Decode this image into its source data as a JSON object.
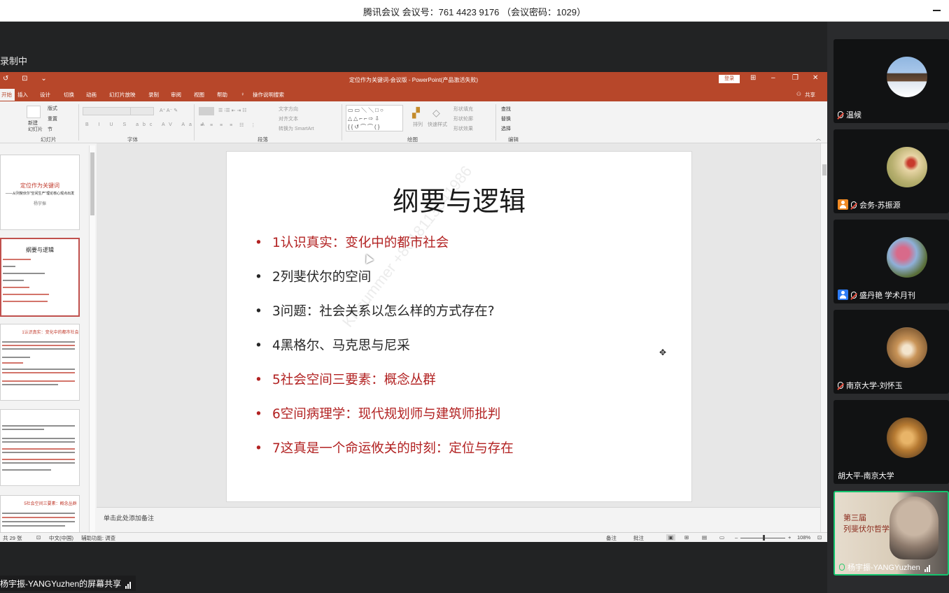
{
  "meeting": {
    "title": "腾讯会议 会议号：761 4423 9176 （会议密码：1029）",
    "recording": "录制中",
    "share_label": "杨宇振-YANGYuzhen的屏幕共享"
  },
  "powerpoint": {
    "window_title": "定位作为关键词-会议版  -  PowerPoint(产品激活失败)",
    "login_button": "登录",
    "share_button": "共享",
    "tell_me": "操作说明搜索",
    "tabs": [
      "开始",
      "插入",
      "设计",
      "切换",
      "动画",
      "幻灯片放映",
      "录制",
      "审阅",
      "视图",
      "帮助"
    ],
    "ribbon_groups": [
      "幻灯片",
      "字体",
      "段落",
      "绘图",
      "编辑"
    ],
    "ribbon_items": {
      "new_slide": "新建\n幻灯片",
      "layout": "版式",
      "reset": "重置",
      "section": "节",
      "text_direction": "文字方向",
      "align_text": "对齐文本",
      "smartart": "转换为 SmartArt",
      "arrange": "排列",
      "quick_styles": "快速样式",
      "shape_fill": "形状填充",
      "shape_outline": "形状轮廓",
      "shape_effects": "形状效果",
      "find": "查找",
      "replace": "替换",
      "select": "选择"
    },
    "thumbnails": [
      {
        "title": "定位作为关键词",
        "subtitle": "——从列斐伏尔“空间生产”理论核心观点出发",
        "author": "杨宇振"
      },
      {
        "title": "纲要与逻辑"
      },
      {
        "title": "1认识真实：变化中的都市社会"
      },
      {
        "title": ""
      },
      {
        "title": "5社会空间三要素：概念丛群"
      }
    ],
    "slide": {
      "title": "纲要与逻辑",
      "bullets": [
        {
          "text": "1认识真实：变化中的都市社会",
          "color": "red"
        },
        {
          "text": "2列斐伏尔的空间",
          "color": "black"
        },
        {
          "text": "3问题：社会关系以怎么样的方式存在?",
          "color": "black"
        },
        {
          "text": "4黑格尔、马克思与尼采",
          "color": "black"
        },
        {
          "text": "5社会空间三要素：概念丛群",
          "color": "red"
        },
        {
          "text": "6空间病理学：现代规划师与建筑师批判",
          "color": "red"
        },
        {
          "text": "7这真是一个命运攸关的时刻：定位与存在",
          "color": "red"
        }
      ],
      "watermark": "KKsummer +8618113041986"
    },
    "notes_placeholder": "单击此处添加备注",
    "status": {
      "slide_count": "共 29 张",
      "language": "中文(中国)",
      "accessibility": "辅助功能: 调查",
      "notes": "备注",
      "comments": "批注",
      "zoom": "108%"
    }
  },
  "participants": [
    {
      "name": "温候",
      "mic": "muted",
      "badge": false
    },
    {
      "name": "会务-苏振源",
      "mic": "muted",
      "badge": "orange"
    },
    {
      "name": "盛丹艳 学术月刊",
      "mic": "muted",
      "badge": "blue"
    },
    {
      "name": "南京大学-刘怀玉",
      "mic": "muted",
      "badge": false
    },
    {
      "name": "胡大平-南京大学",
      "mic": "none",
      "badge": false
    },
    {
      "name": "杨宇振-YANGYuzhen",
      "mic": "on",
      "badge": false,
      "speaking": true
    }
  ],
  "colors": {
    "ppt_accent": "#b7472a",
    "slide_red": "#b22222",
    "speaker_border": "#14c46e"
  }
}
